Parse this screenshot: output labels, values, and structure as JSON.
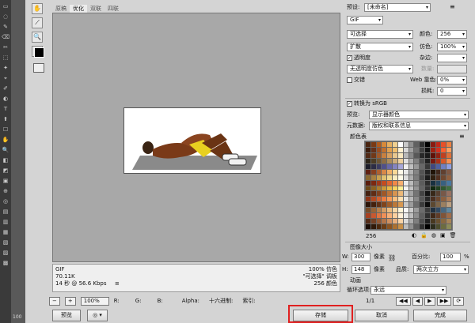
{
  "ps_tools": [
    "▭",
    "◌",
    "✎",
    "⌫",
    "✂",
    "⬚",
    "✦",
    "⌖",
    "✐",
    "◐",
    "T",
    "⬆",
    "☐",
    "✋",
    "🔍",
    "◧",
    "◩",
    "▣",
    "⊕",
    "◎",
    "▤",
    "▥",
    "▦",
    "▧",
    "▨",
    "▩"
  ],
  "ps_bottom_label": "100",
  "tools": {
    "hand": "✋",
    "slice": "⟋",
    "zoom": "🔍",
    "eyedropper": "✒"
  },
  "tabs": [
    "原稿",
    "优化",
    "双联",
    "四联"
  ],
  "info": {
    "format": "GIF",
    "size": "70.11K",
    "time": "14 秒 @ 56.6 Kbps",
    "time_icon": "≡",
    "dither_pct": "100% 仿色",
    "palette": "\"可选择\" 调板",
    "colors": "256 颜色"
  },
  "status_bar": {
    "zoom": "100%",
    "r": "R:",
    "g": "G:",
    "b": "B:",
    "alpha": "Alpha:",
    "hex": "十六进制:",
    "index": "索引:",
    "nav": [
      "◀◀",
      "◀",
      "▶",
      "▶▶",
      "⟳",
      "↻"
    ]
  },
  "buttons": {
    "preview": "预览",
    "save": "存储",
    "cancel": "取消",
    "done": "完成"
  },
  "right": {
    "preset_label": "预设:",
    "preset_value": "[未命名]",
    "format": "GIF",
    "reduction": "可选择",
    "colors_label": "颜色:",
    "colors_value": "256",
    "dither": "扩散",
    "dither_label": "仿色:",
    "dither_value": "100%",
    "transparency_label": "透明度",
    "matte_label": "杂边:",
    "no_trans_dither": "无透明度仿色",
    "amount_label": "数量:",
    "interlaced_label": "交错",
    "web_snap_label": "Web 靠色:",
    "web_snap_value": "0%",
    "lossy_label": "损耗:",
    "lossy_value": "0",
    "convert_srgb": "转换为 sRGB",
    "preview_label": "预览:",
    "preview_value": "显示器颜色",
    "metadata_label": "元数据:",
    "metadata_value": "版权和联系信息",
    "color_table_label": "颜色表",
    "color_count": "256",
    "image_size_label": "图像大小",
    "w_label": "W:",
    "w_value": "300",
    "h_label": "H:",
    "h_value": "148",
    "unit": "像素",
    "percent_label": "百分比:",
    "percent_value": "100",
    "percent_unit": "%",
    "quality_label": "品质:",
    "quality_value": "两次立方",
    "animation_label": "动画",
    "loop_label": "循环选项:",
    "loop_value": "永远",
    "frame_counter": "1/1"
  },
  "colors": {
    "highlight": "#e02020",
    "table": [
      "#4a2410",
      "#7a3a14",
      "#b05a1c",
      "#d88a3a",
      "#e8b060",
      "#f0d090",
      "#ffffff",
      "#c8c8c8",
      "#909090",
      "#606060",
      "#303030",
      "#000000",
      "#8a1a10",
      "#c02818",
      "#e85028",
      "#f08040",
      "#3c1c0c",
      "#64301a",
      "#9a4c20",
      "#c07030",
      "#e0a050",
      "#f0c070",
      "#fff0d0",
      "#d8d8d8",
      "#a0a0a0",
      "#707070",
      "#404040",
      "#101010",
      "#a02010",
      "#d03020",
      "#ff6030",
      "#ffa060",
      "#502814",
      "#703818",
      "#a05828",
      "#c88040",
      "#d8a060",
      "#e8c890",
      "#f8e8c0",
      "#b8b8b8",
      "#888888",
      "#585858",
      "#282828",
      "#1a1a1a",
      "#601008",
      "#902010",
      "#c04020",
      "#e07038",
      "#2c2418",
      "#4c3c24",
      "#6c5434",
      "#8c6c44",
      "#ac8c5c",
      "#ccac7c",
      "#ecd0a0",
      "#e0e0e0",
      "#b0b0b0",
      "#808080",
      "#505050",
      "#202020",
      "#781810",
      "#a83018",
      "#d85828",
      "#f89050",
      "#1c1c28",
      "#2c2c44",
      "#3c3c60",
      "#50508a",
      "#6868a8",
      "#8484c0",
      "#a8a8d8",
      "#f0f0f0",
      "#c0c0c0",
      "#989898",
      "#686868",
      "#383838",
      "#404880",
      "#5060a0",
      "#7080c0",
      "#90a0e0",
      "#602010",
      "#884020",
      "#b06030",
      "#d88848",
      "#f0b068",
      "#f8d898",
      "#fff8e8",
      "#e8e8e8",
      "#b4b4b4",
      "#848484",
      "#545454",
      "#242424",
      "#201408",
      "#40281c",
      "#604030",
      "#805844",
      "#8a6830",
      "#a88040",
      "#c8a050",
      "#e0c070",
      "#f0d890",
      "#f8ecc0",
      "#fffae8",
      "#dcdcdc",
      "#acacac",
      "#7c7c7c",
      "#4c4c4c",
      "#1c1c1c",
      "#302010",
      "#503020",
      "#704830",
      "#906040",
      "#5a1c0c",
      "#7c2810",
      "#a03818",
      "#c44c20",
      "#e06630",
      "#f08848",
      "#f8b070",
      "#ececec",
      "#bcbcbc",
      "#8c8c8c",
      "#5c5c5c",
      "#2c2c2c",
      "#183040",
      "#284860",
      "#386080",
      "#4878a0",
      "#6c4818",
      "#8c6020",
      "#ac7c2c",
      "#cc9838",
      "#e8b848",
      "#f8d460",
      "#fff098",
      "#f4f4f4",
      "#c4c4c4",
      "#949494",
      "#646464",
      "#343434",
      "#102810",
      "#204020",
      "#305830",
      "#407040",
      "#442010",
      "#602c14",
      "#80401c",
      "#a05828",
      "#c07438",
      "#d89450",
      "#ecb878",
      "#d0d0d0",
      "#a4a4a4",
      "#747474",
      "#444444",
      "#141414",
      "#382818",
      "#584030",
      "#785848",
      "#987060",
      "#8c3418",
      "#b04820",
      "#d06030",
      "#ec7c40",
      "#f89c58",
      "#fcc080",
      "#ffe0b0",
      "#e4e4e4",
      "#b8b8b8",
      "#888888",
      "#585858",
      "#282828",
      "#4c3020",
      "#6c4830",
      "#8c6040",
      "#ac7c58",
      "#2c1408",
      "#44200c",
      "#603014",
      "#80441c",
      "#a05c28",
      "#bc7838",
      "#d89850",
      "#c8c8c8",
      "#9c9c9c",
      "#6c6c6c",
      "#3c3c3c",
      "#0c0c0c",
      "#5c4830",
      "#7c6448",
      "#9c8060",
      "#bca080",
      "#784c28",
      "#986438",
      "#b8804c",
      "#d49c64",
      "#ecbc80",
      "#f8d8a8",
      "#fff4d8",
      "#f8f8f8",
      "#cccccc",
      "#9c9c9c",
      "#6c6c6c",
      "#3c3c3c",
      "#203040",
      "#304860",
      "#486880",
      "#6088a0",
      "#a84020",
      "#c85830",
      "#e07440",
      "#f09058",
      "#f8b078",
      "#fcd0a0",
      "#fff0d8",
      "#eaeaea",
      "#bebebe",
      "#8e8e8e",
      "#5e5e5e",
      "#2e2e2e",
      "#402818",
      "#603c28",
      "#805438",
      "#a06c48",
      "#542c18",
      "#744024",
      "#945834",
      "#b47448",
      "#d09060",
      "#e8b080",
      "#f8d4a8",
      "#dadada",
      "#aeaeae",
      "#7e7e7e",
      "#4e4e4e",
      "#1e1e1e",
      "#483820",
      "#685030",
      "#886840",
      "#a88458",
      "#1a0c04",
      "#301808",
      "#4c280c",
      "#6c3c14",
      "#8c5420",
      "#ac7030",
      "#c89048",
      "#bcbcbc",
      "#909090",
      "#606060",
      "#303030",
      "#000000",
      "#2c2c1c",
      "#4c4c2c",
      "#6c6c40",
      "#8c8c58"
    ]
  }
}
